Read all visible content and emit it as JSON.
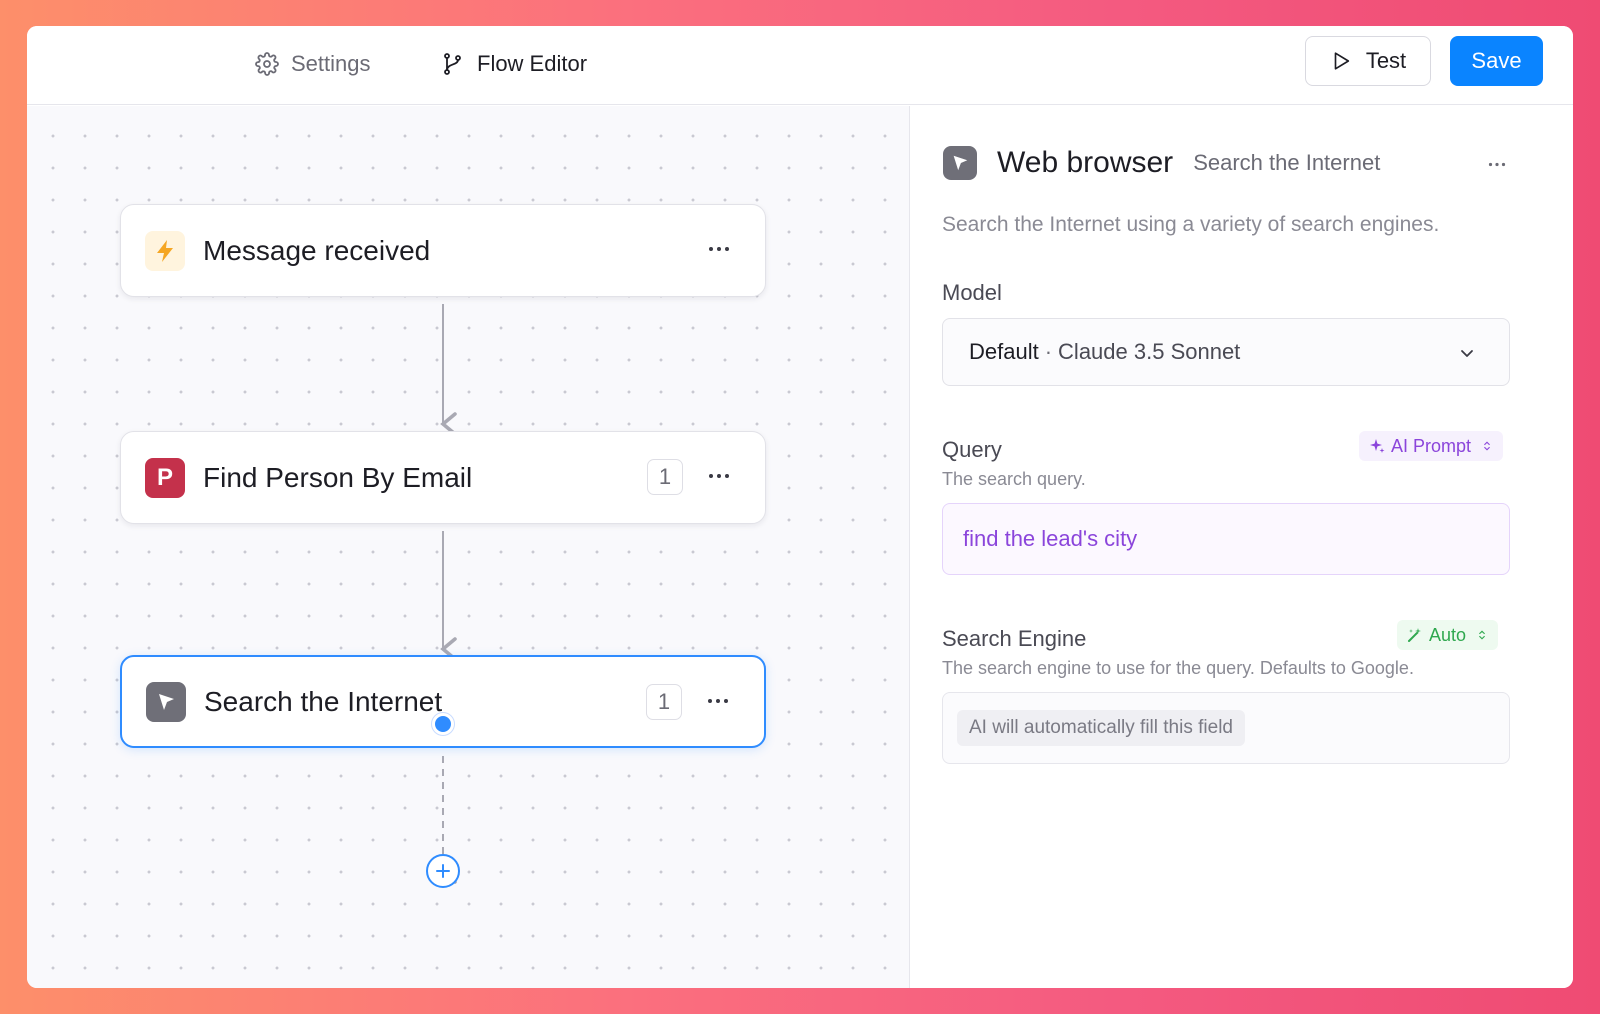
{
  "topbar": {
    "tabs": [
      {
        "label": "Settings",
        "icon": "gear-icon"
      },
      {
        "label": "Flow Editor",
        "icon": "git-branch-icon"
      }
    ],
    "test_label": "Test",
    "save_label": "Save"
  },
  "canvas": {
    "nodes": [
      {
        "title": "Message received",
        "icon": "lightning-icon",
        "badge": null
      },
      {
        "title": "Find Person By Email",
        "icon": "p-logo-icon",
        "icon_letter": "P",
        "badge": "1"
      },
      {
        "title": "Search the Internet",
        "icon": "cursor-arrow-icon",
        "badge": "1",
        "selected": true
      }
    ]
  },
  "panel": {
    "title": "Web browser",
    "subtitle": "Search the Internet",
    "description": "Search the Internet using a variety of search engines.",
    "model": {
      "label": "Model",
      "value_strong": "Default",
      "separator": "·",
      "value_model": "Claude 3.5 Sonnet"
    },
    "query": {
      "label": "Query",
      "help": "The search query.",
      "mode": "AI Prompt",
      "value": "find the lead's city"
    },
    "search_engine": {
      "label": "Search Engine",
      "help": "The search engine to use for the query. Defaults to Google.",
      "mode": "Auto",
      "placeholder": "AI will automatically fill this field"
    }
  },
  "colors": {
    "accent": "#0a84ff",
    "ai_purple": "#8b45db",
    "auto_green": "#2fa84f",
    "lightning_orange": "#f5a623",
    "p_logo_red": "#c4314b"
  }
}
